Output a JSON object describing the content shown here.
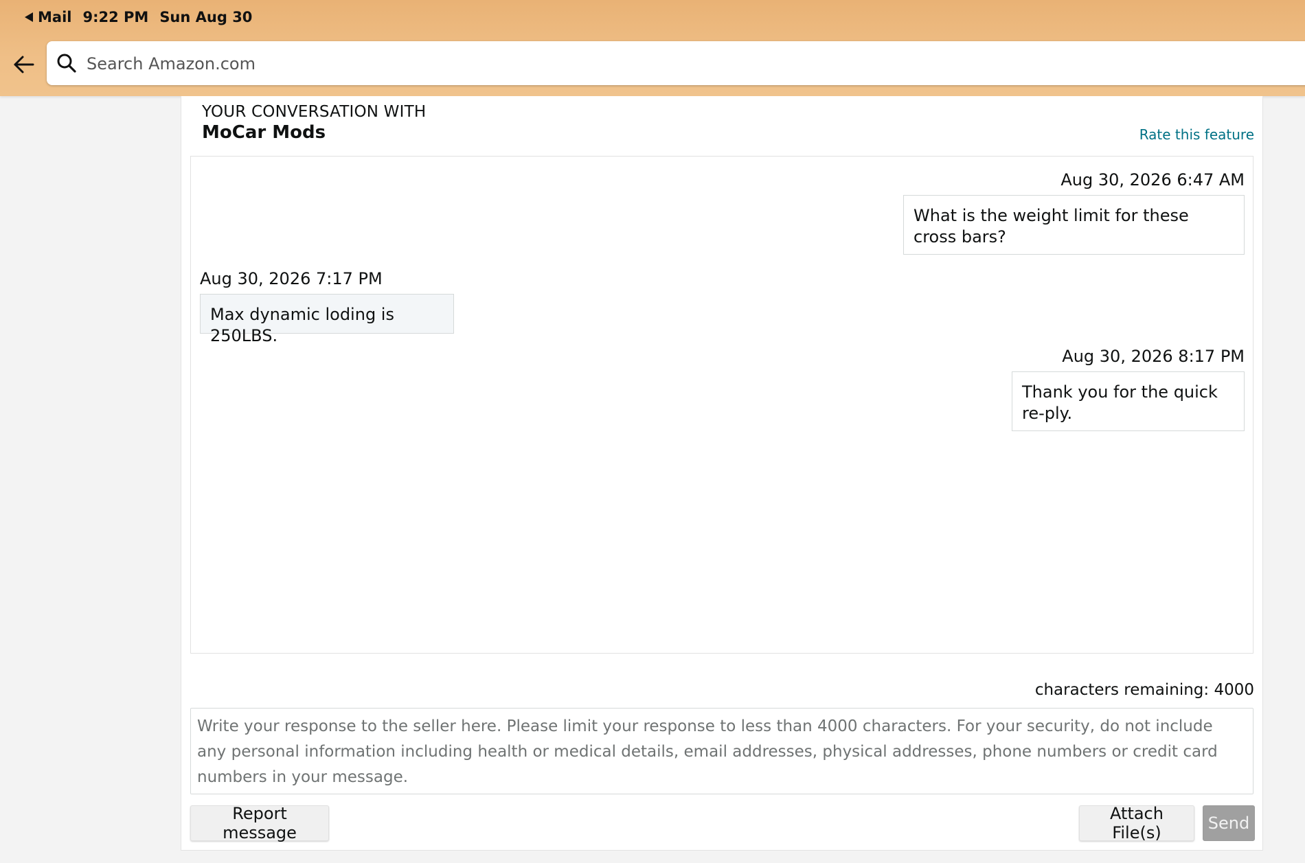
{
  "status_bar": {
    "back_app": "Mail",
    "time": "9:22 PM",
    "date": "Sun Aug 30"
  },
  "search": {
    "placeholder": "Search Amazon.com",
    "icon": "search-icon"
  },
  "conversation": {
    "heading": "YOUR CONVERSATION WITH",
    "seller_name": "MoCar Mods",
    "rate_link": "Rate this feature",
    "messages": [
      {
        "direction": "sent",
        "timestamp": "Aug 30, 2026 6:47 AM",
        "text": "What is the weight limit for these cross bars?"
      },
      {
        "direction": "received",
        "timestamp": "Aug 30, 2026 7:17 PM",
        "text": "Max dynamic loding is 250LBS."
      },
      {
        "direction": "sent",
        "timestamp": "Aug 30, 2026 8:17 PM",
        "text": "Thank you for the quick re-ply."
      }
    ]
  },
  "composer": {
    "chars_remaining": "characters remaining: 4000",
    "placeholder": "Write your response to the seller here. Please limit your response to less than 4000 characters. For your security, do not include any personal information including health or medical details, email addresses, physical addresses, phone numbers or credit card numbers in your message.",
    "report_label": "Report message",
    "attach_label": "Attach File(s)",
    "send_label": "Send"
  },
  "colors": {
    "header_orange": "#efbf87",
    "link_teal": "#007185",
    "send_disabled": "#a0a0a0"
  }
}
